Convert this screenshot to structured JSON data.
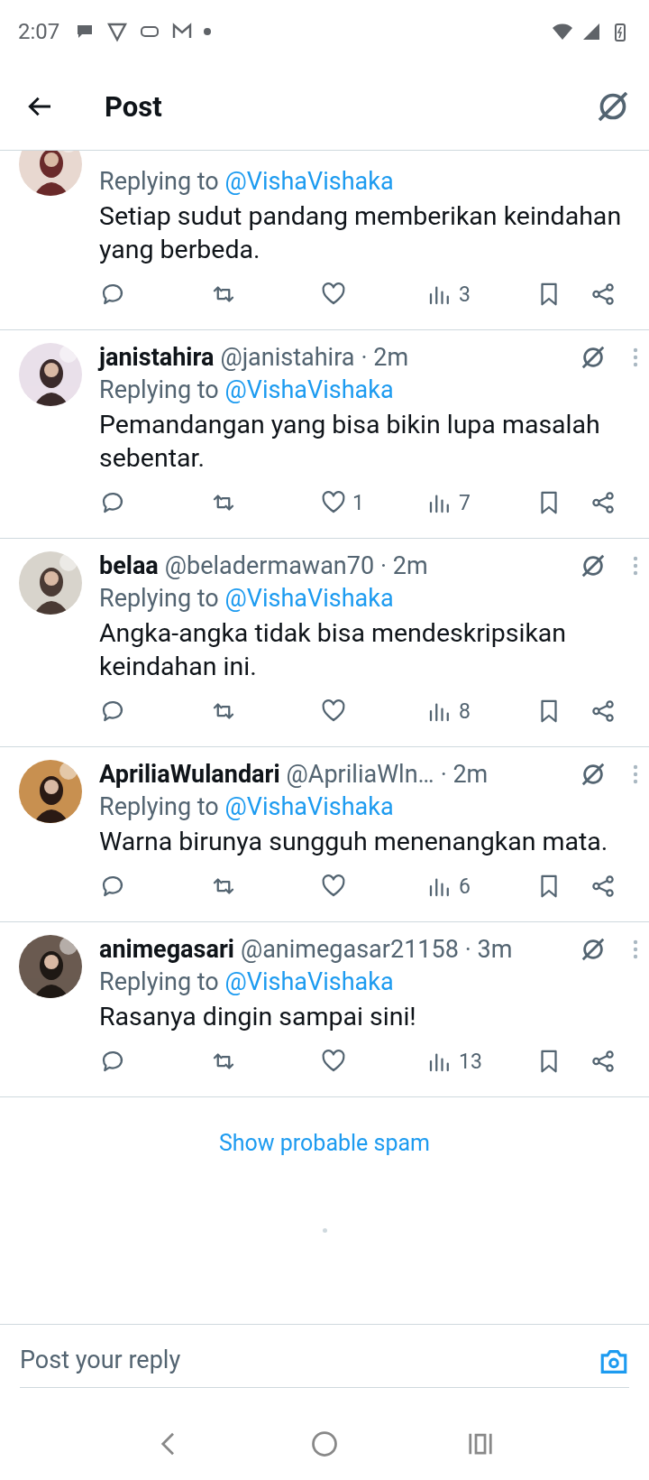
{
  "status_bar": {
    "time": "2:07"
  },
  "header": {
    "title": "Post"
  },
  "replies": [
    {
      "kind": "partial",
      "replying_label": "Replying to",
      "replying_to": "@VishaVishaka",
      "text": "Setiap sudut pandang memberikan keindahan yang berbeda.",
      "views": "3"
    },
    {
      "kind": "full",
      "name": "janistahira",
      "handle": "@janistahira",
      "time": "· 2m",
      "replying_label": "Replying to",
      "replying_to": "@VishaVishaka",
      "text": "Pemandangan yang bisa bikin lupa masalah sebentar.",
      "likes": "1",
      "views": "7"
    },
    {
      "kind": "full",
      "name": "belaa",
      "handle": "@beladermawan70",
      "time": "· 2m",
      "replying_label": "Replying to",
      "replying_to": "@VishaVishaka",
      "text": "Angka-angka tidak bisa mendeskripsikan keindahan ini.",
      "views": "8"
    },
    {
      "kind": "full",
      "name": "ApriliaWulandari",
      "handle": "@ApriliaWln…",
      "time": "· 2m",
      "replying_label": "Replying to",
      "replying_to": "@VishaVishaka",
      "text": "Warna birunya sungguh menenangkan mata.",
      "views": "6"
    },
    {
      "kind": "full",
      "name": "animegasari",
      "handle": "@animegasar21158",
      "time": "· 3m",
      "replying_label": "Replying to",
      "replying_to": "@VishaVishaka",
      "text": "Rasanya dingin sampai sini!",
      "views": "13"
    }
  ],
  "spam_link": "Show probable spam",
  "reply_bar": {
    "placeholder": "Post your reply"
  }
}
